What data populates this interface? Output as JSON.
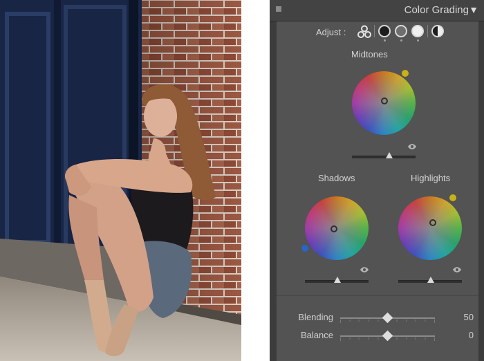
{
  "photo": {
    "alt": "ballet dancer sitting against brick wall",
    "colors": {
      "door": "#1b2a4d",
      "brick": "#8b4a36",
      "sidewalk": "#b4aca1"
    }
  },
  "panel": {
    "title": "Color Grading",
    "collapse_icon": "triangle-down-icon",
    "adjust_label": "Adjust :",
    "modes": [
      "3-way",
      "shadows",
      "midtones",
      "highlights",
      "global"
    ],
    "midtones_label": "Midtones",
    "shadows_label": "Shadows",
    "highlights_label": "Highlights",
    "handle_colors": {
      "midtones": "#c9b215",
      "shadows": "#2a64c9",
      "highlights": "#c9b215"
    },
    "blending": {
      "label": "Blending",
      "value": "50",
      "fraction": 0.5
    },
    "balance": {
      "label": "Balance",
      "value": "0",
      "fraction": 0.5
    }
  }
}
